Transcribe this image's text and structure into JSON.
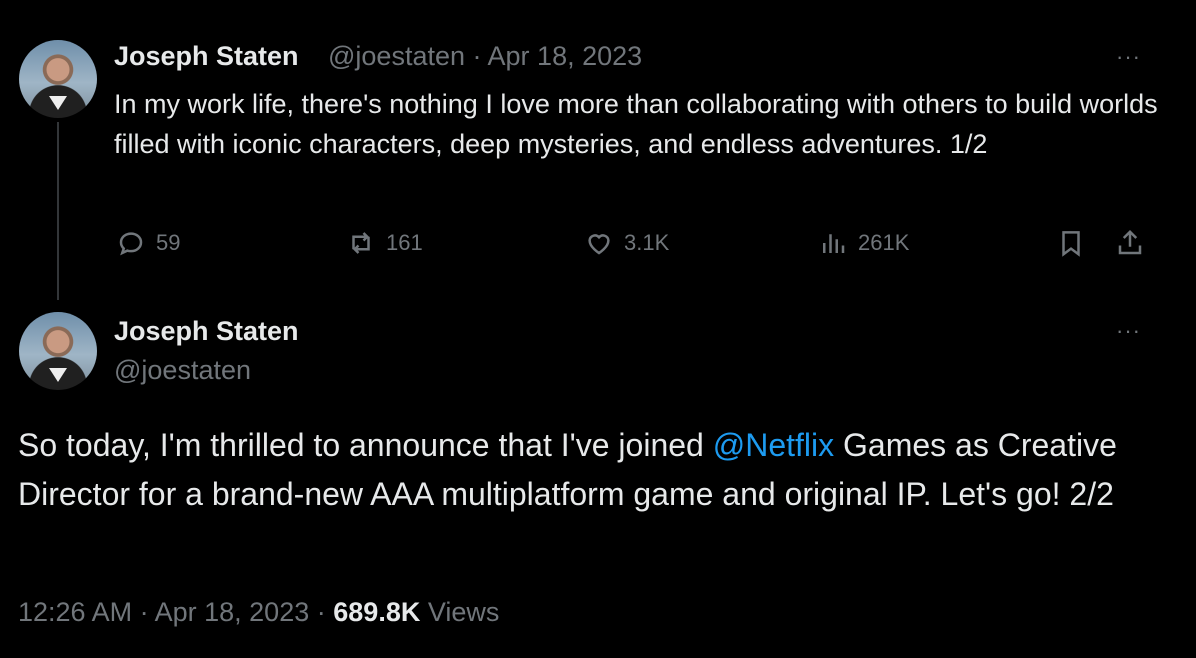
{
  "tweet1": {
    "author_name": "Joseph Staten",
    "handle": "@joestaten",
    "separator": "·",
    "date": "Apr 18, 2023",
    "more": "···",
    "text": "In my work life, there's nothing I love more than collaborating with others to build worlds filled with iconic characters, deep mysteries, and endless adventures. 1/2",
    "stats": {
      "replies": "59",
      "retweets": "161",
      "likes": "3.1K",
      "views": "261K"
    }
  },
  "tweet2": {
    "author_name": "Joseph Staten",
    "handle": "@joestaten",
    "more": "···",
    "text_before": "So today, I'm thrilled to announce that I've joined ",
    "mention": "@Netflix",
    "text_after": " Games as Creative Director for a brand-new AAA multiplatform game and original IP. Let's go! 2/2",
    "time": "12:26 AM",
    "separator": "·",
    "date": "Apr 18, 2023",
    "views_count": "689.8K",
    "views_label": "Views"
  },
  "icons": [
    "reply-icon",
    "retweet-icon",
    "like-icon",
    "views-icon",
    "bookmark-icon",
    "share-icon",
    "more-icon"
  ],
  "colors": {
    "background": "#000000",
    "text": "#e7e9ea",
    "muted": "#71767b",
    "link": "#1d9bf0"
  }
}
